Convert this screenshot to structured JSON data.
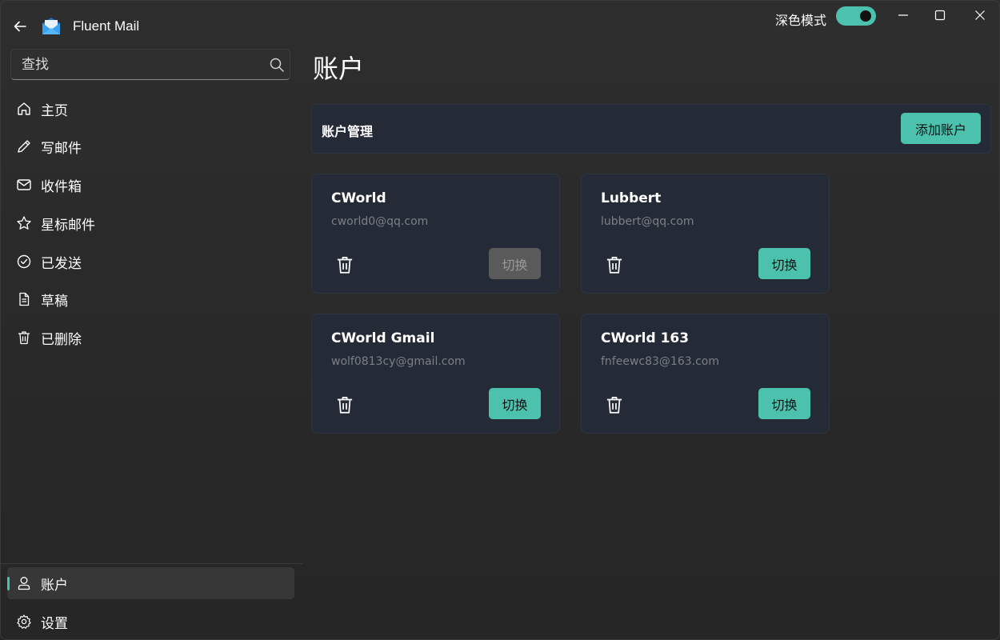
{
  "app": {
    "title": "Fluent Mail"
  },
  "theme": {
    "label": "深色模式",
    "enabled": true,
    "accent": "#4cc2ae"
  },
  "search": {
    "placeholder": "查找"
  },
  "nav": {
    "items": [
      {
        "label": "主页",
        "icon": "home-icon"
      },
      {
        "label": "写邮件",
        "icon": "pencil-icon"
      },
      {
        "label": "收件箱",
        "icon": "mail-icon"
      },
      {
        "label": "星标邮件",
        "icon": "star-icon"
      },
      {
        "label": "已发送",
        "icon": "check-circle-icon"
      },
      {
        "label": "草稿",
        "icon": "document-icon"
      },
      {
        "label": "已删除",
        "icon": "trash-icon"
      }
    ],
    "bottom": [
      {
        "label": "账户",
        "icon": "person-icon",
        "active": true
      },
      {
        "label": "设置",
        "icon": "gear-icon"
      }
    ]
  },
  "main": {
    "title": "账户",
    "management": {
      "title": "账户管理",
      "add_label": "添加账户"
    },
    "accounts": [
      {
        "name": "CWorld",
        "email": "cworld0@qq.com",
        "switch_label": "切换",
        "current": true
      },
      {
        "name": "Lubbert",
        "email": "lubbert@qq.com",
        "switch_label": "切换",
        "current": false
      },
      {
        "name": "CWorld Gmail",
        "email": "wolf0813cy@gmail.com",
        "switch_label": "切换",
        "current": false
      },
      {
        "name": "CWorld 163",
        "email": "fnfeewc83@163.com",
        "switch_label": "切换",
        "current": false
      }
    ]
  }
}
